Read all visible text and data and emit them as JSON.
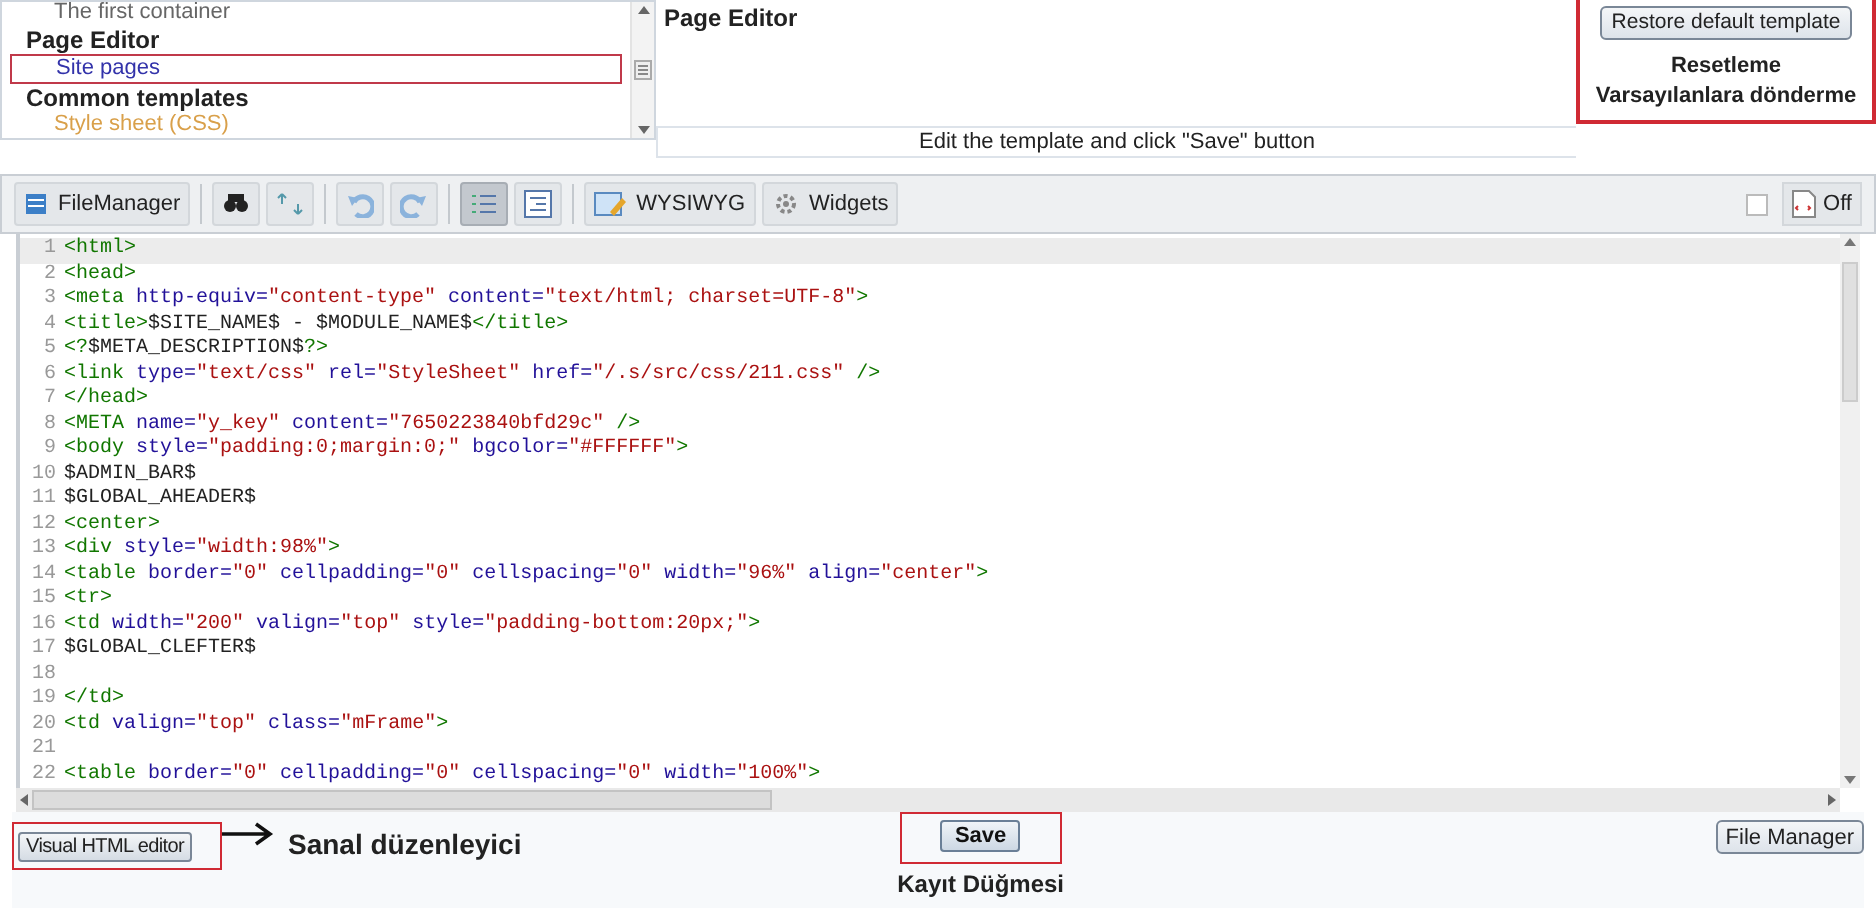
{
  "tree": {
    "items": [
      {
        "kind": "item",
        "label": "The first container",
        "selected": false
      },
      {
        "kind": "heading",
        "label": "Page Editor",
        "selected": false
      },
      {
        "kind": "item",
        "label": "Site pages",
        "selected": true
      },
      {
        "kind": "heading",
        "label": "Common templates",
        "selected": false
      },
      {
        "kind": "item",
        "label": "Style sheet (CSS)",
        "selected": false
      }
    ]
  },
  "page_title": "Page Editor",
  "restore_button": "Restore default template",
  "restore_note": [
    "Resetleme",
    "Varsayılanlara dönderme"
  ],
  "hint": "Edit the template and click \"Save\" button",
  "toolbar": [
    {
      "kind": "filemanager",
      "label": "FileManager",
      "pressed": false
    },
    {
      "kind": "search",
      "pressed": false
    },
    {
      "kind": "replace",
      "pressed": false
    },
    {
      "kind": "undo",
      "pressed": false
    },
    {
      "kind": "redo",
      "pressed": false
    },
    {
      "kind": "linenumbers",
      "pressed": true
    },
    {
      "kind": "indent",
      "pressed": false
    },
    {
      "kind": "wysiwyg",
      "label": "WYSIWYG",
      "pressed": false
    },
    {
      "kind": "widgets",
      "label": "Widgets",
      "pressed": false
    }
  ],
  "wrap_toggle": {
    "checked": false,
    "label": "Off"
  },
  "code_lines": [
    {
      "number": "1",
      "text": "<html>",
      "current": true
    },
    {
      "number": "2",
      "text": "<head>",
      "current": false
    },
    {
      "number": "3",
      "text": "<meta http-equiv=\"content-type\" content=\"text/html; charset=UTF-8\">",
      "current": false
    },
    {
      "number": "4",
      "text": "<title>$SITE_NAME$ - $MODULE_NAME$</title>",
      "current": false
    },
    {
      "number": "5",
      "text": "<?$META_DESCRIPTION$?>",
      "current": false
    },
    {
      "number": "6",
      "text": "<link type=\"text/css\" rel=\"StyleSheet\" href=\"/.s/src/css/211.css\" />",
      "current": false
    },
    {
      "number": "7",
      "text": "</head>",
      "current": false
    },
    {
      "number": "8",
      "text": "<META name=\"y_key\" content=\"7650223840bfd29c\" />",
      "current": false
    },
    {
      "number": "9",
      "text": "<body style=\"padding:0;margin:0;\" bgcolor=\"#FFFFFF\">",
      "current": false
    },
    {
      "number": "10",
      "text": "$ADMIN_BAR$",
      "current": false
    },
    {
      "number": "11",
      "text": "$GLOBAL_AHEADER$",
      "current": false
    },
    {
      "number": "12",
      "text": "<center>",
      "current": false
    },
    {
      "number": "13",
      "text": "<div style=\"width:98%\">",
      "current": false
    },
    {
      "number": "14",
      "text": "<table border=\"0\" cellpadding=\"0\" cellspacing=\"0\" width=\"96%\" align=\"center\">",
      "current": false
    },
    {
      "number": "15",
      "text": "<tr>",
      "current": false
    },
    {
      "number": "16",
      "text": "<td width=\"200\" valign=\"top\" style=\"padding-bottom:20px;\">",
      "current": false
    },
    {
      "number": "17",
      "text": "$GLOBAL_CLEFTER$",
      "current": false
    },
    {
      "number": "18",
      "current": false
    },
    {
      "number": "19",
      "text": "</td>",
      "current": false
    },
    {
      "number": "20",
      "text": "<td valign=\"top\" class=\"mFrame\">",
      "current": false
    },
    {
      "number": "21",
      "current": false
    },
    {
      "number": "22",
      "text": "<table border=\"0\" cellpadding=\"0\" cellspacing=\"0\" width=\"100%\">",
      "current": false
    }
  ],
  "visual_button": "Visual HTML editor",
  "visual_note": "Sanal düzenleyici",
  "save_button": "Save",
  "save_note": "Kayıt Düğmesi",
  "file_manager_button": "File Manager"
}
